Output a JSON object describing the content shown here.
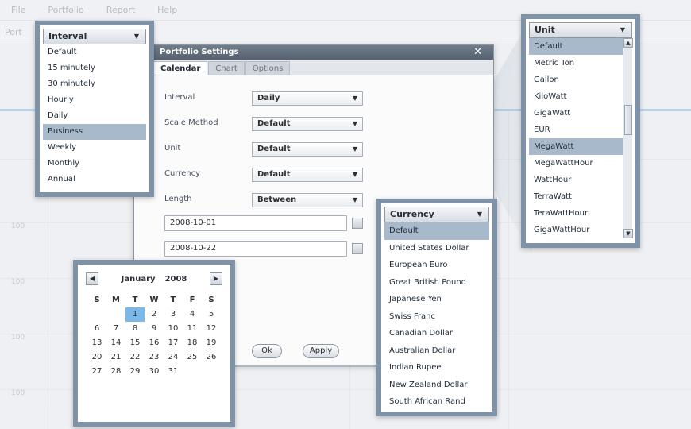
{
  "app": {
    "menu": [
      "File",
      "Portfolio",
      "Report",
      "Help"
    ],
    "toolbar_label": "Port",
    "y_labels": [
      "100",
      "100",
      "100",
      "100"
    ]
  },
  "dialog": {
    "title": "Portfolio Settings",
    "close_label": "✕",
    "tabs": [
      {
        "label": "Calendar",
        "active": true
      },
      {
        "label": "Chart",
        "active": false
      },
      {
        "label": "Options",
        "active": false
      }
    ],
    "fields": [
      {
        "label": "Interval",
        "value": "Daily"
      },
      {
        "label": "Scale Method",
        "value": "Default"
      },
      {
        "label": "Unit",
        "value": "Default"
      },
      {
        "label": "Currency",
        "value": "Default"
      },
      {
        "label": "Length",
        "value": "Between"
      }
    ],
    "start_date": "2008-10-01",
    "end_date": "2008-10-22",
    "ok_label": "Ok",
    "apply_label": "Apply"
  },
  "interval": {
    "title": "Interval",
    "items": [
      "Default",
      "15 minutely",
      "30 minutely",
      "Hourly",
      "Daily",
      "Business",
      "Weekly",
      "Monthly",
      "Annual"
    ],
    "selected": 5
  },
  "unit": {
    "title": "Unit",
    "items": [
      "Default",
      "Metric Ton",
      "Gallon",
      "KiloWatt",
      "GigaWatt",
      "EUR",
      "MegaWatt",
      "MegaWattHour",
      "WattHour",
      "TerraWatt",
      "TeraWattHour",
      "GigaWattHour"
    ],
    "selected_items": [
      0,
      6
    ]
  },
  "currency": {
    "title": "Currency",
    "items": [
      "Default",
      "United States Dollar",
      "European Euro",
      "Great British Pound",
      "Japanese Yen",
      "Swiss Franc",
      "Canadian Dollar",
      "Australian Dollar",
      "Indian Rupee",
      "New Zealand Dollar",
      "South African Rand"
    ],
    "selected": 0
  },
  "calendar": {
    "month": "January",
    "year": "2008",
    "prev_icon": "◀",
    "next_icon": "▶",
    "weekdays": [
      "S",
      "M",
      "T",
      "W",
      "T",
      "F",
      "S"
    ],
    "weeks": [
      [
        "",
        "",
        "1",
        "2",
        "3",
        "4",
        "5"
      ],
      [
        "6",
        "7",
        "8",
        "9",
        "10",
        "11",
        "12"
      ],
      [
        "13",
        "14",
        "15",
        "16",
        "17",
        "18",
        "19"
      ],
      [
        "20",
        "21",
        "22",
        "23",
        "24",
        "25",
        "26"
      ],
      [
        "27",
        "28",
        "29",
        "30",
        "31",
        "",
        ""
      ]
    ],
    "selected_day": "1"
  },
  "colors": {
    "callout_border": "#7e93a8",
    "selection": "#a9b9cc",
    "calendar_selection": "#7ab8ea"
  }
}
